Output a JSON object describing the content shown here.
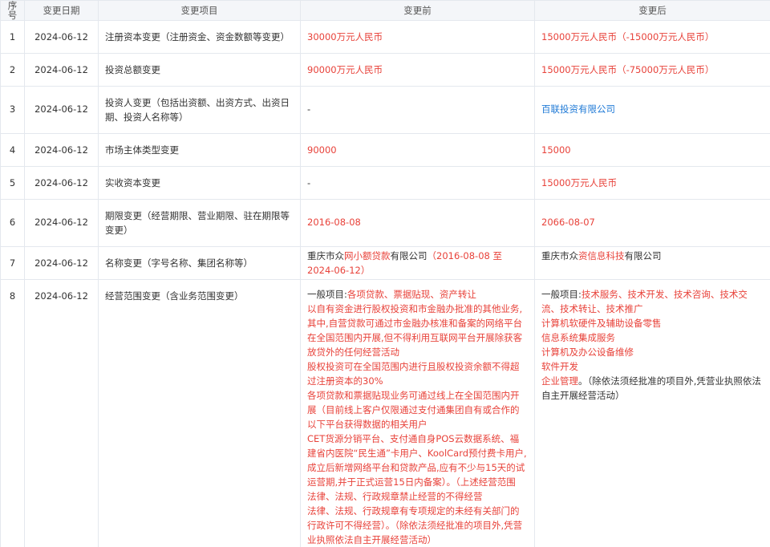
{
  "columns": [
    "序号",
    "变更日期",
    "变更项目",
    "变更前",
    "变更后"
  ],
  "rows": [
    {
      "idx": "1",
      "date": "2024-06-12",
      "item": "注册资本变更（注册资金、资金数额等变更）",
      "before": "30000万元人民币",
      "after": "15000万元人民币（-15000万元人民币）"
    },
    {
      "idx": "2",
      "date": "2024-06-12",
      "item": "投资总额变更",
      "before": "90000万元人民币",
      "after": "15000万元人民币（-75000万元人民币）"
    },
    {
      "idx": "3",
      "date": "2024-06-12",
      "item": "投资人变更（包括出资额、出资方式、出资日期、投资人名称等）",
      "before": "-",
      "after": "百联投资有限公司"
    },
    {
      "idx": "4",
      "date": "2024-06-12",
      "item": "市场主体类型变更",
      "before": "90000",
      "after": "15000"
    },
    {
      "idx": "5",
      "date": "2024-06-12",
      "item": "实收资本变更",
      "before": "-",
      "after": "15000万元人民币"
    },
    {
      "idx": "6",
      "date": "2024-06-12",
      "item": "期限变更（经营期限、营业期限、驻在期限等变更）",
      "before": "2016-08-08",
      "after": "2066-08-07"
    },
    {
      "idx": "7",
      "date": "2024-06-12",
      "item": "名称变更（字号名称、集团名称等）",
      "before_parts": [
        "重庆市众",
        "网小额贷款",
        "有限公司",
        "（2016-08-08 至 2024-06-12）"
      ],
      "after_parts": [
        "重庆市众",
        "资信息科技",
        "有限公司"
      ]
    },
    {
      "idx": "8",
      "date": "2024-06-12",
      "item": "经营范围变更（含业务范围变更）",
      "before_head": "一般项目:",
      "before_lines": [
        "各项贷款、票据贴现、资产转让",
        "以自有资金进行股权投资和市金融办批准的其他业务,其中,自营贷款可通过市金融办核准和备案的网络平台在全国范围内开展,但不得利用互联网平台开展除获客放贷外的任何经营活动",
        "股权投资可在全国范围内进行且股权投资余额不得超过注册资本的30%",
        "各项贷款和票据贴现业务可通过线上在全国范围内开展（目前线上客户仅限通过支付通集团自有或合作的以下平台获得数据的相关用户",
        "CET货源分销平台、支付通自身POS云数据系统、福建省内医院“民生通”卡用户、KoolCard预付费卡用户,成立后新增网络平台和贷款产品,应有不少与15天的试运营期,并于正式运营15日内备案）。（上述经营范围",
        "法律、法规、行政规章禁止经营的不得经营",
        "法律、法规、行政规章有专项规定的未经有关部门的行政许可不得经营）。（除依法须经批准的项目外,凭营业执照依法自主开展经营活动）"
      ],
      "after_head": "一般项目:",
      "after_lines": [
        "技术服务、技术开发、技术咨询、技术交流、技术转让、技术推广",
        "计算机软硬件及辅助设备零售",
        "信息系统集成服务",
        "计算机及办公设备维修",
        "软件开发",
        "企业管理"
      ],
      "after_tail": "。（除依法须经批准的项目外,凭营业执照依法自主开展经营活动）"
    }
  ]
}
